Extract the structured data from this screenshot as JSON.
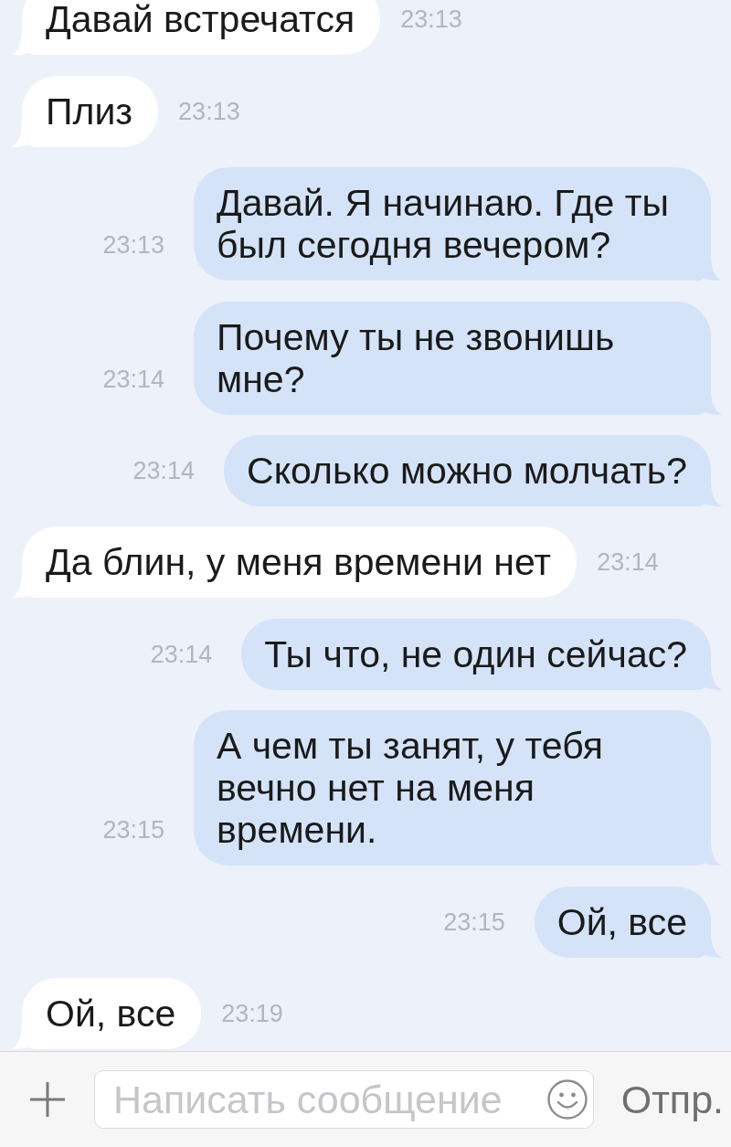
{
  "messages": [
    {
      "kind": "incoming",
      "text": "Давай встречатся",
      "time": "23:13"
    },
    {
      "kind": "incoming",
      "text": "Плиз",
      "time": "23:13"
    },
    {
      "kind": "outgoing",
      "text": "Давай. Я начинаю. Где ты был сегодня вечером?",
      "time": "23:13"
    },
    {
      "kind": "outgoing",
      "text": "Почему ты не звонишь мне?",
      "time": "23:14"
    },
    {
      "kind": "outgoing",
      "text": "Сколько можно молчать?",
      "time": "23:14"
    },
    {
      "kind": "incoming",
      "text": "Да блин, у меня времени нет",
      "time": "23:14"
    },
    {
      "kind": "outgoing",
      "text": "Ты что, не один сейчас?",
      "time": "23:14"
    },
    {
      "kind": "outgoing",
      "text": "А чем ты занят, у тебя вечно нет на меня времени.",
      "time": "23:15"
    },
    {
      "kind": "outgoing",
      "text": "Ой, все",
      "time": "23:15"
    },
    {
      "kind": "incoming",
      "text": "Ой, все",
      "time": "23:19"
    }
  ],
  "composer": {
    "placeholder": "Написать сообщение",
    "send_label": "Отпр."
  }
}
